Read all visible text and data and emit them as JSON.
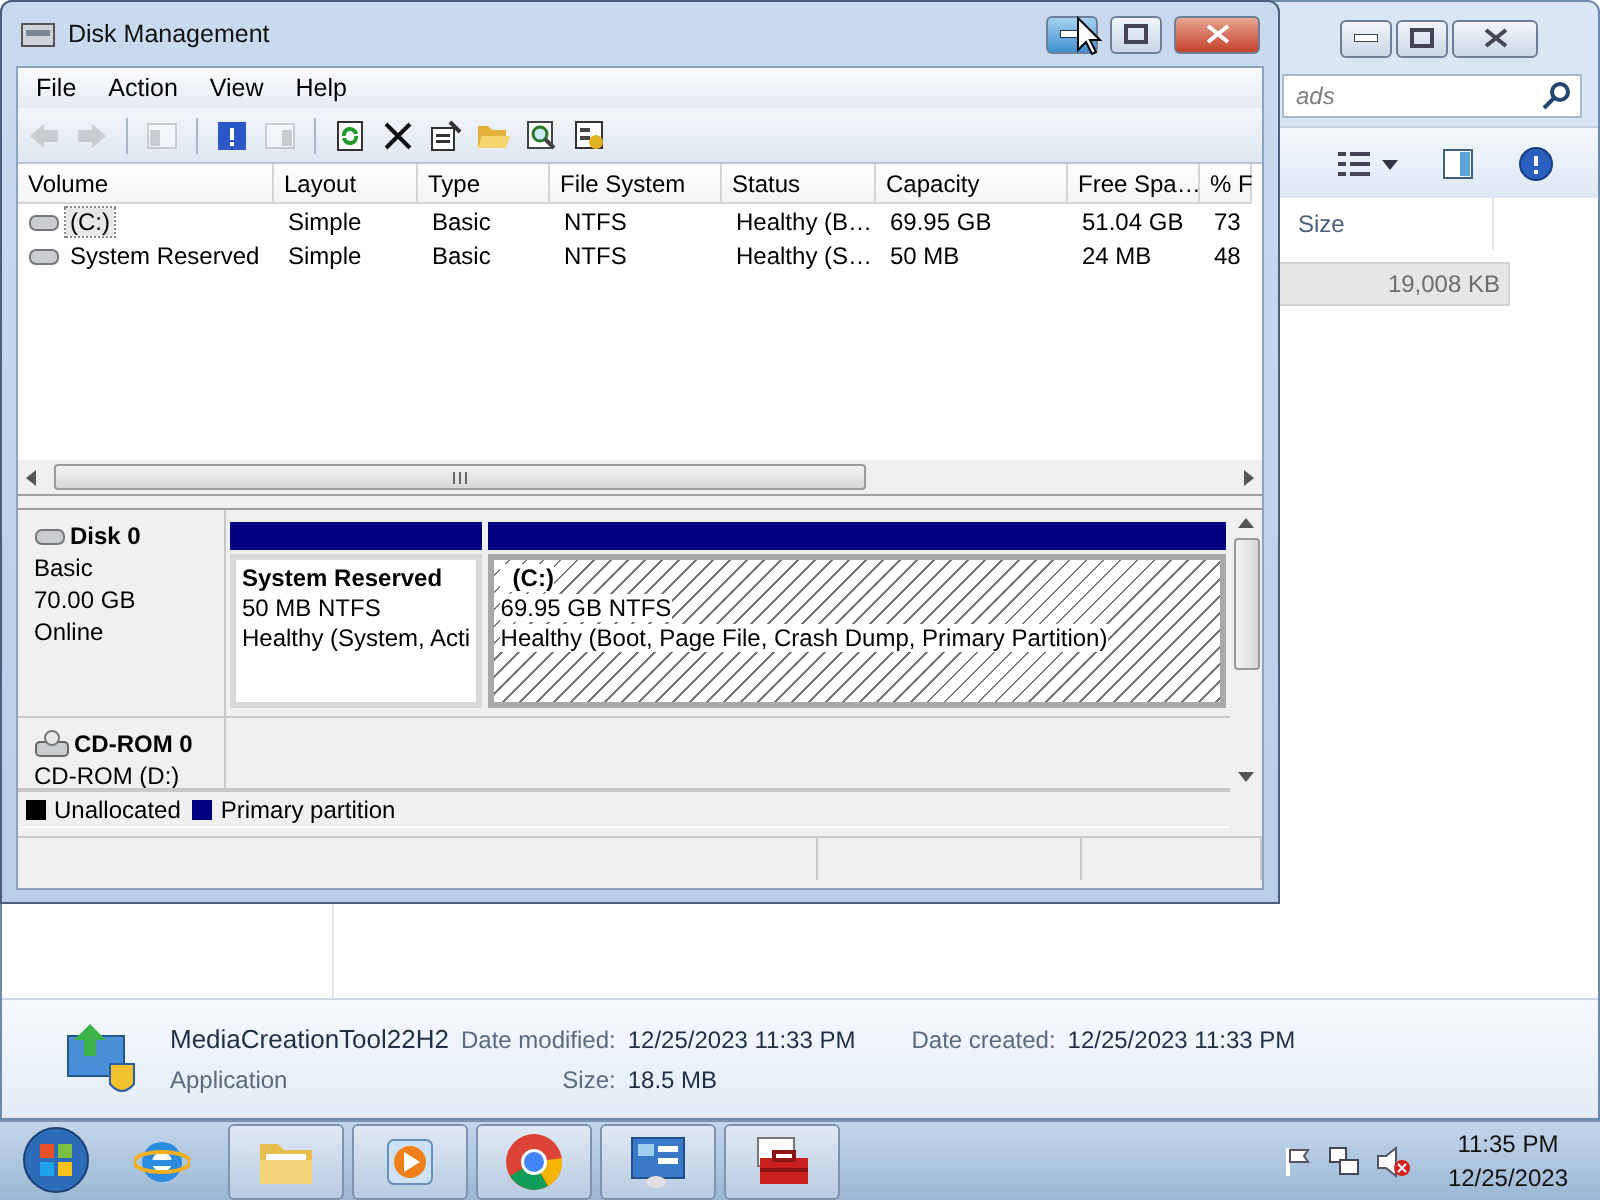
{
  "explorer": {
    "search": {
      "placeholder": "ads"
    },
    "columns": [
      "Size"
    ],
    "rows": [
      {
        "size": "19,008 KB",
        "selected": true
      }
    ],
    "details": {
      "name": "MediaCreationTool22H2",
      "type": "Application",
      "fields": [
        {
          "label": "Date modified:",
          "value": "12/25/2023 11:33 PM"
        },
        {
          "label": "Date created:",
          "value": "12/25/2023 11:33 PM"
        },
        {
          "label": "Size:",
          "value": "18.5 MB"
        }
      ]
    }
  },
  "disk_management": {
    "title": "Disk Management",
    "menu": [
      "File",
      "Action",
      "View",
      "Help"
    ],
    "toolbar": [
      {
        "kind": "back",
        "disabled": true
      },
      {
        "kind": "forward",
        "disabled": true
      },
      {
        "kind": "sep"
      },
      {
        "kind": "tree",
        "disabled": true
      },
      {
        "kind": "sep"
      },
      {
        "kind": "help",
        "disabled": false
      },
      {
        "kind": "pane",
        "disabled": true
      },
      {
        "kind": "sep"
      },
      {
        "kind": "refresh",
        "disabled": false
      },
      {
        "kind": "delete",
        "disabled": false
      },
      {
        "kind": "properties",
        "disabled": false
      },
      {
        "kind": "open",
        "disabled": false
      },
      {
        "kind": "find",
        "disabled": false
      },
      {
        "kind": "settings",
        "disabled": false
      }
    ],
    "columns": [
      "Volume",
      "Layout",
      "Type",
      "File System",
      "Status",
      "Capacity",
      "Free Spa…",
      "% F"
    ],
    "rows": [
      {
        "cells": [
          "(C:)",
          "Simple",
          "Basic",
          "NTFS",
          "Healthy (B…",
          "69.95 GB",
          "51.04 GB",
          "73"
        ],
        "selected": true
      },
      {
        "cells": [
          "System Reserved",
          "Simple",
          "Basic",
          "NTFS",
          "Healthy (S…",
          "50 MB",
          "24 MB",
          "48"
        ],
        "selected": false
      }
    ],
    "disks": [
      {
        "kind": "disk",
        "name": "Disk 0",
        "lines": [
          "Basic",
          "70.00 GB",
          "Online"
        ],
        "partitions": [
          {
            "name": "System Reserved",
            "size": "50 MB NTFS",
            "status": "Healthy (System, Acti",
            "selected": false
          },
          {
            "name": "(C:)",
            "size": "69.95 GB NTFS",
            "status": "Healthy (Boot, Page File, Crash Dump, Primary Partition)",
            "selected": true
          }
        ]
      },
      {
        "kind": "cdrom",
        "name": "CD-ROM 0",
        "lines": [
          "CD-ROM (D:)"
        ]
      }
    ],
    "legend": [
      {
        "label": "Unallocated",
        "color": "#000000"
      },
      {
        "label": "Primary partition",
        "color": "#000080"
      }
    ]
  },
  "taskbar": {
    "apps": [
      {
        "kind": "ie",
        "open": false
      },
      {
        "kind": "folder",
        "open": true
      },
      {
        "kind": "media",
        "open": true
      },
      {
        "kind": "chrome",
        "open": true
      },
      {
        "kind": "control",
        "open": true
      },
      {
        "kind": "toolbox",
        "open": true
      }
    ],
    "tray": {
      "time": "11:35 PM",
      "date": "12/25/2023"
    }
  }
}
